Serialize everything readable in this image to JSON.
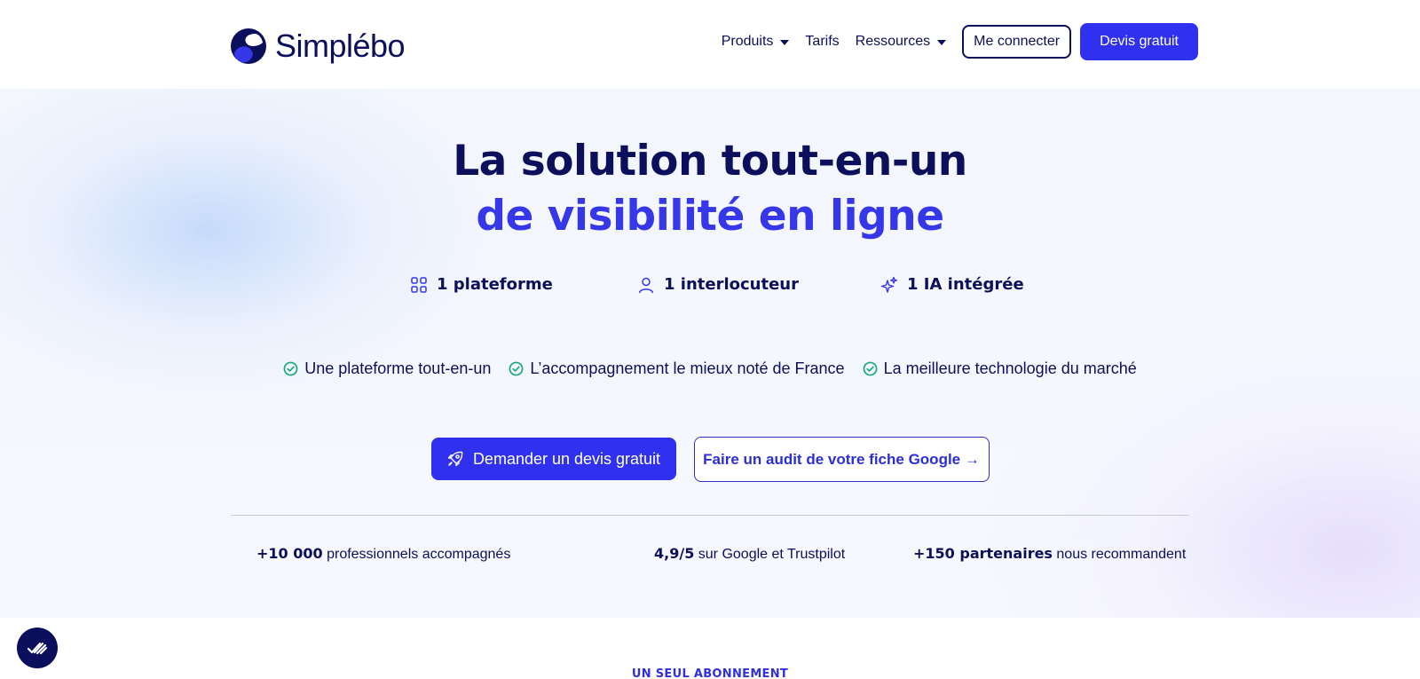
{
  "header": {
    "logo_text": "Simplébo",
    "nav": [
      {
        "label": "Produits",
        "has_dropdown": true
      },
      {
        "label": "Tarifs",
        "has_dropdown": false
      },
      {
        "label": "Ressources",
        "has_dropdown": true
      }
    ],
    "login_label": "Me connecter",
    "quote_label": "Devis gratuit"
  },
  "hero": {
    "title_line1": "La solution tout-en-un",
    "title_line2": "de visibilité en ligne",
    "pillars": [
      {
        "icon": "grid-icon",
        "label": "1 plateforme"
      },
      {
        "icon": "user-icon",
        "label": "1 interlocuteur"
      },
      {
        "icon": "sparkles-icon",
        "label": "1 IA intégrée"
      }
    ],
    "checks": [
      "Une plateforme tout-en-un",
      "L’accompagnement le mieux noté de France",
      "La meilleure technologie du marché"
    ],
    "cta_primary": "Demander un devis gratuit",
    "cta_secondary": "Faire un audit de votre fiche Google →",
    "stats": [
      {
        "bold": "+10 000",
        "text": " professionnels accompagnés"
      },
      {
        "bold": "4,9/5",
        "text": " sur Google et Trustpilot"
      },
      {
        "bold": "+150 partenaires",
        "text": " nous recommandent"
      }
    ]
  },
  "next_section": {
    "label": "UN SEUL ABONNEMENT"
  },
  "colors": {
    "navy": "#0c0f5c",
    "brand_blue": "#3030f0",
    "accent_blue": "#3737ea",
    "check_green": "#1aa97a"
  }
}
